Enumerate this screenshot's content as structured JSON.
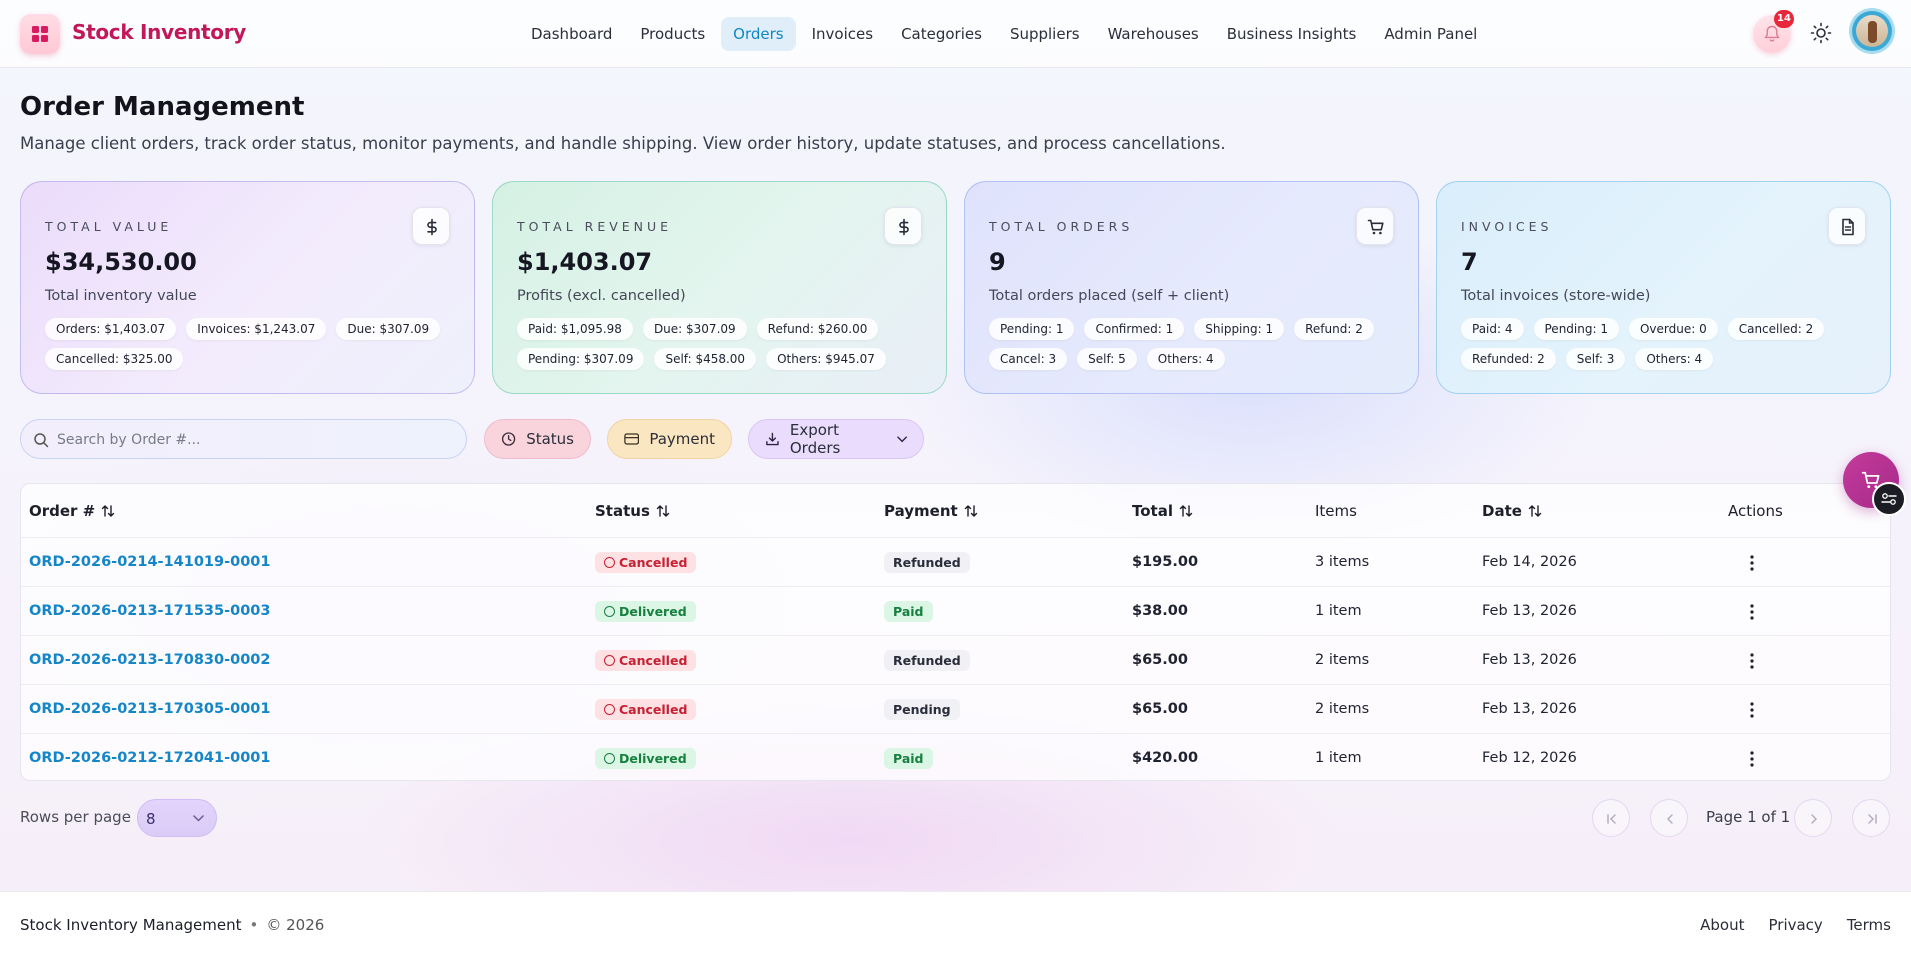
{
  "header": {
    "brand": "Stock Inventory",
    "nav": [
      "Dashboard",
      "Products",
      "Orders",
      "Invoices",
      "Categories",
      "Suppliers",
      "Warehouses",
      "Business Insights",
      "Admin Panel"
    ],
    "active_nav": "Orders",
    "notification_count": "14",
    "icons": [
      "logo-grid-icon",
      "bell-icon",
      "sun-icon",
      "avatar"
    ]
  },
  "page": {
    "title": "Order Management",
    "description": "Manage client orders, track order status, monitor payments, and handle shipping. View order history, update statuses, and process cancellations."
  },
  "cards": [
    {
      "label": "TOTAL VALUE",
      "value": "$34,530.00",
      "sub": "Total inventory value",
      "icon": "dollar-icon",
      "chips": [
        "Orders: $1,403.07",
        "Invoices: $1,243.07",
        "Due: $307.09",
        "Cancelled: $325.00"
      ]
    },
    {
      "label": "TOTAL REVENUE",
      "value": "$1,403.07",
      "sub": "Profits (excl. cancelled)",
      "icon": "dollar-icon",
      "chips": [
        "Paid: $1,095.98",
        "Due: $307.09",
        "Refund: $260.00",
        "Pending: $307.09",
        "Self: $458.00",
        "Others: $945.07"
      ]
    },
    {
      "label": "TOTAL ORDERS",
      "value": "9",
      "sub": "Total orders placed (self + client)",
      "icon": "cart-icon",
      "chips": [
        "Pending: 1",
        "Confirmed: 1",
        "Shipping: 1",
        "Refund: 2",
        "Cancel: 3",
        "Self: 5",
        "Others: 4"
      ]
    },
    {
      "label": "INVOICES",
      "value": "7",
      "sub": "Total invoices (store-wide)",
      "icon": "document-icon",
      "chips": [
        "Paid: 4",
        "Pending: 1",
        "Overdue: 0",
        "Cancelled: 2",
        "Refunded: 2",
        "Self: 3",
        "Others: 4"
      ]
    }
  ],
  "filters": {
    "search_placeholder": "Search by Order #...",
    "status_label": "Status",
    "payment_label": "Payment",
    "export_label": "Export Orders"
  },
  "table": {
    "columns": [
      "Order #",
      "Status",
      "Payment",
      "Total",
      "Items",
      "Date",
      "Actions"
    ],
    "rows": [
      {
        "order": "ORD-2026-0214-141019-0001",
        "status": "Cancelled",
        "payment": "Refunded",
        "total": "$195.00",
        "items": "3 items",
        "date": "Feb 14, 2026"
      },
      {
        "order": "ORD-2026-0213-171535-0003",
        "status": "Delivered",
        "payment": "Paid",
        "total": "$38.00",
        "items": "1 item",
        "date": "Feb 13, 2026"
      },
      {
        "order": "ORD-2026-0213-170830-0002",
        "status": "Cancelled",
        "payment": "Refunded",
        "total": "$65.00",
        "items": "2 items",
        "date": "Feb 13, 2026"
      },
      {
        "order": "ORD-2026-0213-170305-0001",
        "status": "Cancelled",
        "payment": "Pending",
        "total": "$65.00",
        "items": "2 items",
        "date": "Feb 13, 2026"
      },
      {
        "order": "ORD-2026-0212-172041-0001",
        "status": "Delivered",
        "payment": "Paid",
        "total": "$420.00",
        "items": "1 item",
        "date": "Feb 12, 2026"
      }
    ]
  },
  "pagination": {
    "rows_per_page_label": "Rows per page",
    "rows_per_page": "8",
    "page_text": "Page 1 of 1"
  },
  "footer": {
    "title": "Stock Inventory Management",
    "separator": "•",
    "year": "© 2026",
    "links": [
      "About",
      "Privacy",
      "Terms"
    ]
  },
  "colors": {
    "brand": "#c2185b",
    "accent": "#1486c8",
    "cancelled": "#c62033",
    "delivered": "#17803f"
  }
}
